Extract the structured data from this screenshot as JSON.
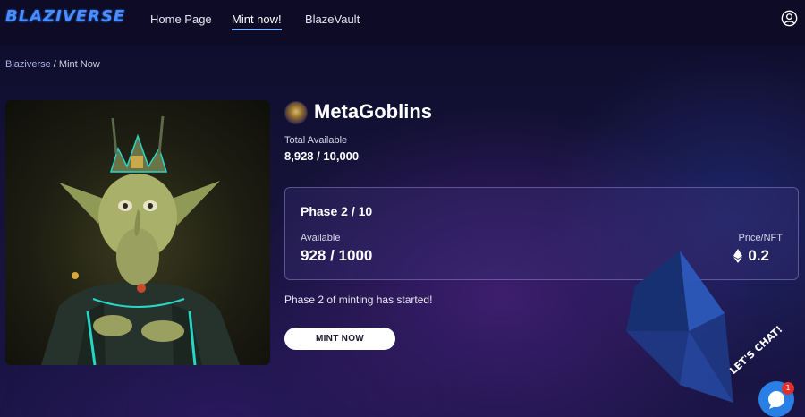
{
  "header": {
    "logo_text": "BLAZIVERSE",
    "nav": [
      {
        "label": "Home Page",
        "active": false
      },
      {
        "label": "Mint now!",
        "active": true
      },
      {
        "label": "BlazeVault",
        "active": false
      }
    ],
    "user_icon": "user-circle-icon"
  },
  "breadcrumb": {
    "root": "Blaziverse",
    "separator": " / ",
    "current": "Mint Now"
  },
  "collection": {
    "name": "MetaGoblins",
    "total_label": "Total Available",
    "total_value": "8,928 / 10,000"
  },
  "phase": {
    "title": "Phase 2 / 10",
    "available_label": "Available",
    "available_value": "928 / 1000",
    "price_label": "Price/NFT",
    "price_value": "0.2",
    "price_icon": "ethereum-icon"
  },
  "status_text": "Phase 2 of minting has started!",
  "mint_button": "MINT NOW",
  "chat": {
    "label": "LET'S CHAT!",
    "badge_count": "1"
  },
  "colors": {
    "nav_underline": "#7fb3ff",
    "logo": "#4a8dff",
    "chat_bubble": "#2a7fe5",
    "badge": "#e0302c"
  }
}
